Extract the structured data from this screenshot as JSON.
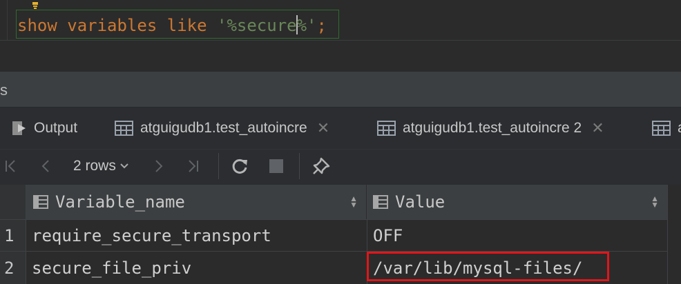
{
  "editor": {
    "keyword_show": "show",
    "keyword_variables": "variables",
    "keyword_like": "like",
    "string_open": "'%secure",
    "string_close": "%'",
    "terminator": ";"
  },
  "services": {
    "title": "s"
  },
  "tabs": [
    {
      "label": "Output",
      "icon": "output-icon"
    },
    {
      "label": "atguigudb1.test_autoincre",
      "icon": "table-icon",
      "closable": true
    },
    {
      "label": "atguigudb1.test_autoincre 2",
      "icon": "table-icon",
      "closable": true
    },
    {
      "label": "a",
      "icon": "table-icon"
    }
  ],
  "toolbar": {
    "rows_label": "2 rows",
    "icons": [
      "first-page-icon",
      "previous-page-icon",
      "next-page-icon",
      "last-page-icon",
      "refresh-icon",
      "stop-icon",
      "pin-icon"
    ]
  },
  "grid": {
    "columns": [
      "Variable_name",
      "Value"
    ],
    "rows": [
      {
        "num": "1",
        "name": "require_secure_transport",
        "value": "OFF"
      },
      {
        "num": "2",
        "name": "secure_file_priv",
        "value": "/var/lib/mysql-files/"
      }
    ]
  },
  "colors": {
    "keyword": "#cc7832",
    "string": "#6a8759",
    "highlight_border": "#e0161b"
  }
}
